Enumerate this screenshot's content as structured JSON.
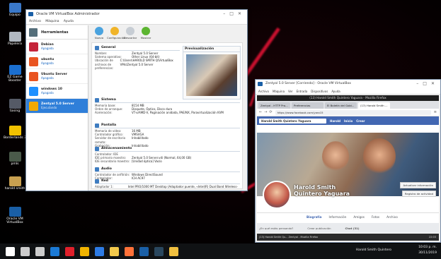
{
  "desktop": {
    "icons": [
      {
        "label": "Equipo",
        "color": "#3a78c9"
      },
      {
        "label": "Papelera",
        "color": "#b0b8c0"
      },
      {
        "label": "EZ Game Booster",
        "color": "#1b6fd1"
      },
      {
        "label": "taxing",
        "color": "#555a66"
      },
      {
        "label": "Borderlands 3",
        "color": "#f2c200"
      },
      {
        "label": "pmls",
        "color": "#4a5a4a"
      },
      {
        "label": "harold smith",
        "color": "#c9a050"
      },
      {
        "label": "Oracle VM VirtualBox",
        "color": "#1a5fa6"
      }
    ]
  },
  "vbox": {
    "title": "Oracle VM VirtualBox Administrador",
    "menu": [
      "Archivo",
      "Máquina",
      "Ayuda"
    ],
    "tools_label": "Herramientas",
    "vms": [
      {
        "name": "Debian",
        "state": "Apagada",
        "color": "#c5243a"
      },
      {
        "name": "ubuntu",
        "state": "Apagada",
        "color": "#e95420"
      },
      {
        "name": "Ubuntu Server",
        "state": "Apagada",
        "color": "#e95420"
      },
      {
        "name": "windows 10",
        "state": "Apagada",
        "color": "#1e90ff"
      },
      {
        "name": "Zentyal 5.0 Server",
        "state": "Ejecutando",
        "color": "#f2a900"
      }
    ],
    "toolbar": [
      {
        "label": "Nueva",
        "color": "#4aa3df"
      },
      {
        "label": "Configuración",
        "color": "#f0b429"
      },
      {
        "label": "Descartar",
        "color": "#c7cdd4"
      },
      {
        "label": "Mostrar",
        "color": "#5cb531"
      }
    ],
    "details": {
      "general": {
        "header": "General",
        "rows": [
          {
            "k": "Nombre:",
            "v": "Zentyal 5.0 Server"
          },
          {
            "k": "Sistema operativo:",
            "v": "Other Linux (64-bit)"
          },
          {
            "k": "Ubicación de archivos de preferencias:",
            "v": "C:\\Users\\HAROLD SMITH Q\\VirtualBox VMs\\Zentyal 5.0 Server"
          }
        ]
      },
      "system": {
        "header": "Sistema",
        "rows": [
          {
            "k": "Memoria base:",
            "v": "8154 MB"
          },
          {
            "k": "Orden de arranque:",
            "v": "Disquete, Óptico, Disco duro"
          },
          {
            "k": "Aceleración:",
            "v": "VT-x/AMD-V, Paginación anidada, PAE/NX, Paravirtualización KVM"
          }
        ]
      },
      "display": {
        "header": "Pantalla",
        "rows": [
          {
            "k": "Memoria de vídeo:",
            "v": "16 MB"
          },
          {
            "k": "Controlador gráfico:",
            "v": "VMSVGA"
          },
          {
            "k": "Servidor de escritorio remoto:",
            "v": "Inhabilitado"
          },
          {
            "k": "Grabación:",
            "v": "Inhabilitado"
          }
        ]
      },
      "storage": {
        "header": "Almacenamiento",
        "rows": [
          {
            "k": "Controlador: IDE",
            "v": ""
          },
          {
            "k": "IDE primario maestro:",
            "v": "Zentyal 5.0 Server.vdi (Normal, 64,00 GB)"
          },
          {
            "k": "IDE secundario maestro:",
            "v": "[Unidad óptica] Vacío"
          }
        ]
      },
      "audio": {
        "header": "Audio",
        "rows": [
          {
            "k": "Controlador de anfitrión:",
            "v": "Windows DirectSound"
          },
          {
            "k": "Controlador:",
            "v": "ICH AC97"
          }
        ]
      },
      "network": {
        "header": "Red",
        "rows": [
          {
            "k": "Adaptador 1:",
            "v": "Intel PRO/1000 MT Desktop (Adaptador puente, «Intel(R) Dual Band Wireless-AC 7265»)"
          },
          {
            "k": "Adaptador 2:",
            "v": "Intel PRO/1000 MT Desktop (Red interna, «intnet»)"
          }
        ]
      },
      "preview": {
        "header": "Previsualización"
      }
    }
  },
  "zentyal": {
    "title": "Zentyal 5.0 Server [Corriendo] - Oracle VM VirtualBox",
    "menu": [
      "Archivo",
      "Máquina",
      "Ver",
      "Entrada",
      "Dispositivos",
      "Ayuda"
    ],
    "firefox": {
      "title": "(13) Harold Smith Quintero Yaguara - Mozilla Firefox",
      "tabs": [
        {
          "label": "Zentyal - HTTP Pro...",
          "active": false
        },
        {
          "label": "Preferencias",
          "active": false
        },
        {
          "label": "El Boletín del Gobi...",
          "active": false
        },
        {
          "label": "(13) Harold Smith ...",
          "active": true
        }
      ],
      "url": "https://www.facebook.com/yaro15",
      "fb": {
        "search": "Harold Smith Quintero Yaguara",
        "nav": [
          "Harold",
          "Inicio",
          "Crear"
        ],
        "name_line1": "Harold Smith",
        "name_line2": "Quintero Yaguara",
        "update_info": "Actualizar información",
        "activity_log": "Registro de actividad",
        "tabs": [
          "Biografía",
          "Información",
          "Amigos",
          "Fotos",
          "Archivo"
        ],
        "bottom_left": "¿En qué estás pensando?",
        "bottom_mid": "Crear publicación",
        "chat": "Chat (31)"
      }
    },
    "vm_taskbar": "(13) Harold Smith Qu...   Zentyal - Mozilla Firefox",
    "vm_clock": "22:03"
  },
  "taskbar": {
    "user": "Harold Smith Quintero",
    "time": "10:03 p. m.",
    "date": "30/11/2019",
    "icons": [
      {
        "name": "windows-start-icon",
        "color": "#ffffff"
      },
      {
        "name": "search-icon",
        "color": "#cccccc"
      },
      {
        "name": "task-view-icon",
        "color": "#cccccc"
      },
      {
        "name": "edge-icon",
        "color": "#1b7ad6"
      },
      {
        "name": "opera-icon",
        "color": "#e0202b"
      },
      {
        "name": "chrome-icon",
        "color": "#f1b400"
      },
      {
        "name": "store-icon",
        "color": "#2d7be5"
      },
      {
        "name": "explorer-icon",
        "color": "#f2c94c"
      },
      {
        "name": "firefox-icon",
        "color": "#ff7139"
      },
      {
        "name": "virtualbox-icon",
        "color": "#1a5fa6"
      },
      {
        "name": "steam-icon",
        "color": "#2a475e"
      },
      {
        "name": "folder-icon",
        "color": "#f0c040"
      }
    ]
  }
}
